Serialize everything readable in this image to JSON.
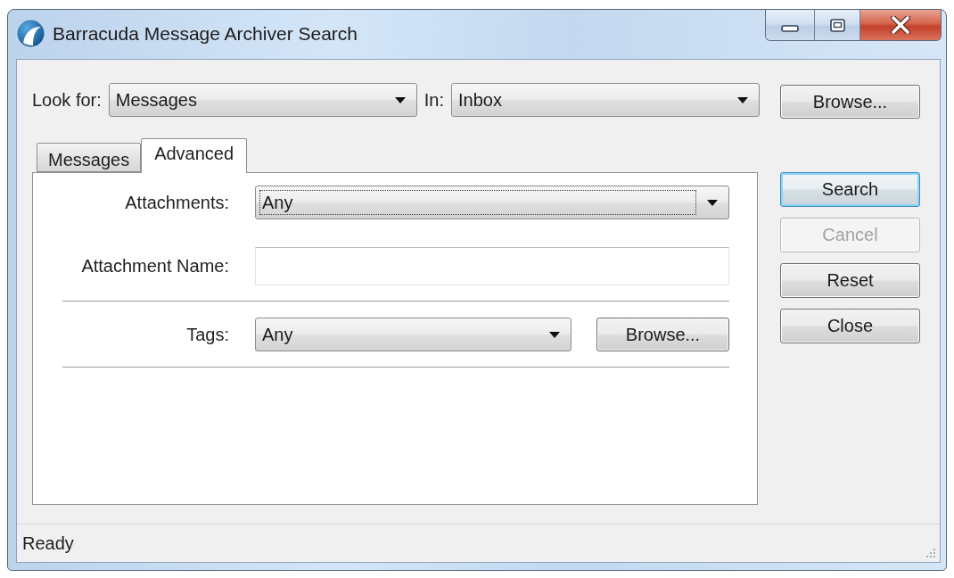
{
  "window": {
    "title": "Barracuda Message Archiver Search"
  },
  "search_scope": {
    "look_for": {
      "label": "Look for:",
      "value": "Messages"
    },
    "in": {
      "label": "In:",
      "value": "Inbox"
    },
    "browse_button": "Browse..."
  },
  "tabs": [
    {
      "label": "Messages",
      "selected": false
    },
    {
      "label": "Advanced",
      "selected": true
    }
  ],
  "tab_panel": {
    "fields": [
      {
        "kind": "dropdown",
        "label": "Attachments:",
        "value": "Any",
        "focused": true,
        "divider_after": false
      },
      {
        "kind": "text",
        "label": "Attachment Name:",
        "divider_after": true
      },
      {
        "kind": "dropdown",
        "label": "Tags:",
        "value": "Any",
        "focused": false,
        "button": "Browse...",
        "divider_after": true
      }
    ]
  },
  "buttons": [
    {
      "label": "Search",
      "default": true,
      "disabled": false
    },
    {
      "label": "Cancel",
      "default": false,
      "disabled": true
    },
    {
      "label": "Reset",
      "default": false,
      "disabled": false
    },
    {
      "label": "Close",
      "default": false,
      "disabled": false
    }
  ],
  "status_bar": {
    "text": "Ready"
  }
}
